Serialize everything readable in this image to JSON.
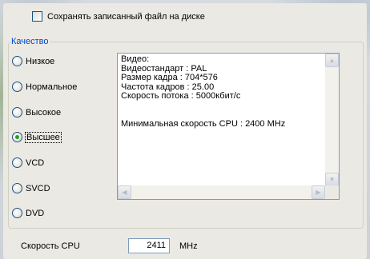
{
  "save_checkbox": {
    "label": "Сохранять записанный файл на диске",
    "checked": false
  },
  "quality": {
    "legend": "Качество",
    "options": [
      {
        "label": "Низкое",
        "checked": false
      },
      {
        "label": "Нормальное",
        "checked": false
      },
      {
        "label": "Высокое",
        "checked": false
      },
      {
        "label": "Высшее",
        "checked": true
      },
      {
        "label": "VCD",
        "checked": false
      },
      {
        "label": "SVCD",
        "checked": false
      },
      {
        "label": "DVD",
        "checked": false
      }
    ],
    "info_lines": [
      "Видео:",
      "Видеостандарт : PAL",
      "Размер кадра : 704*576",
      "Частота кадров : 25.00",
      "Скорость потока : 5000кбит/с",
      "",
      "",
      "Минимальная скорость CPU : 2400 MHz"
    ]
  },
  "cpu": {
    "label": "Скорость CPU",
    "value": "2411",
    "unit": "MHz"
  },
  "colors": {
    "legend": "#0046d5",
    "radio_dot": "#21a121",
    "border": "#7f9db9"
  }
}
